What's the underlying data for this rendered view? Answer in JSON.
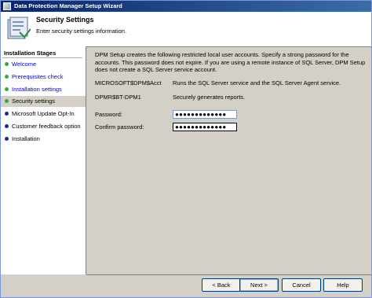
{
  "window": {
    "title": "Data Protection Manager Setup Wizard"
  },
  "header": {
    "title": "Security Settings",
    "subtitle": "Enter security settings information."
  },
  "stages": {
    "heading": "Installation Stages",
    "items": [
      {
        "label": "Welcome",
        "state": "done"
      },
      {
        "label": "Prerequisites check",
        "state": "done"
      },
      {
        "label": "Installation settings",
        "state": "done"
      },
      {
        "label": "Security settings",
        "state": "current"
      },
      {
        "label": "Microsoft Update Opt-In",
        "state": "todo"
      },
      {
        "label": "Customer feedback option",
        "state": "todo"
      },
      {
        "label": "Installation",
        "state": "todo"
      }
    ]
  },
  "content": {
    "intro": "DPM Setup creates the following restricted local user accounts. Specify a strong password for the accounts. This password does not expire. If you are using a remote instance of SQL Server, DPM Setup does not create a SQL Server service account.",
    "accounts": [
      {
        "name": "MICROSOFT$DPM$Acct",
        "description": "Runs the SQL Server service and the SQL Server Agent service."
      },
      {
        "name": "DPMR$BT-DPM1",
        "description": "Securely generates reports."
      }
    ],
    "password_label": "Password:",
    "password_value": "●●●●●●●●●●●●●",
    "confirm_label": "Confirm password:",
    "confirm_value": "●●●●●●●●●●●●●"
  },
  "buttons": {
    "back": "< Back",
    "next": "Next >",
    "cancel": "Cancel",
    "help": "Help"
  }
}
